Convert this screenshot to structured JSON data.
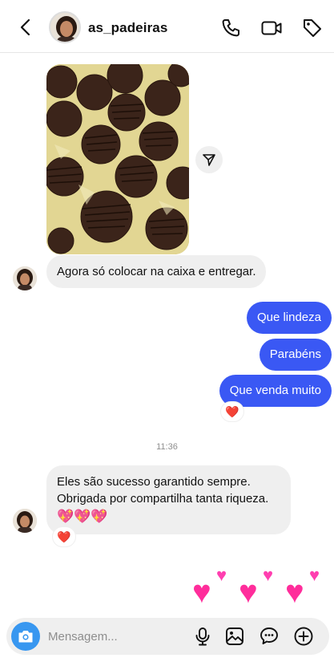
{
  "header": {
    "username": "as_padeiras",
    "icons": [
      "chevron-left-icon",
      "avatar",
      "phone-icon",
      "video-camera-icon",
      "tag-icon"
    ]
  },
  "messages": {
    "incoming_1": "Agora só colocar na caixa e entregar.",
    "outgoing": [
      "Que lindeza",
      "Parabéns",
      "Que venda muito"
    ],
    "reaction_out": "❤️",
    "timestamp": "11:36",
    "incoming_2_line1": "Eles são sucesso garantido sempre.",
    "incoming_2_line2": "Obrigada por compartilha tanta riqueza.",
    "incoming_2_emoji": "💖💖💖",
    "reaction_in": "❤️"
  },
  "composer": {
    "placeholder": "Mensagem..."
  },
  "colors": {
    "outgoing_bubble": "#3a58f4",
    "incoming_bubble": "#efefef",
    "camera_button": "#3897f0",
    "heart": "#ff2d9b"
  }
}
